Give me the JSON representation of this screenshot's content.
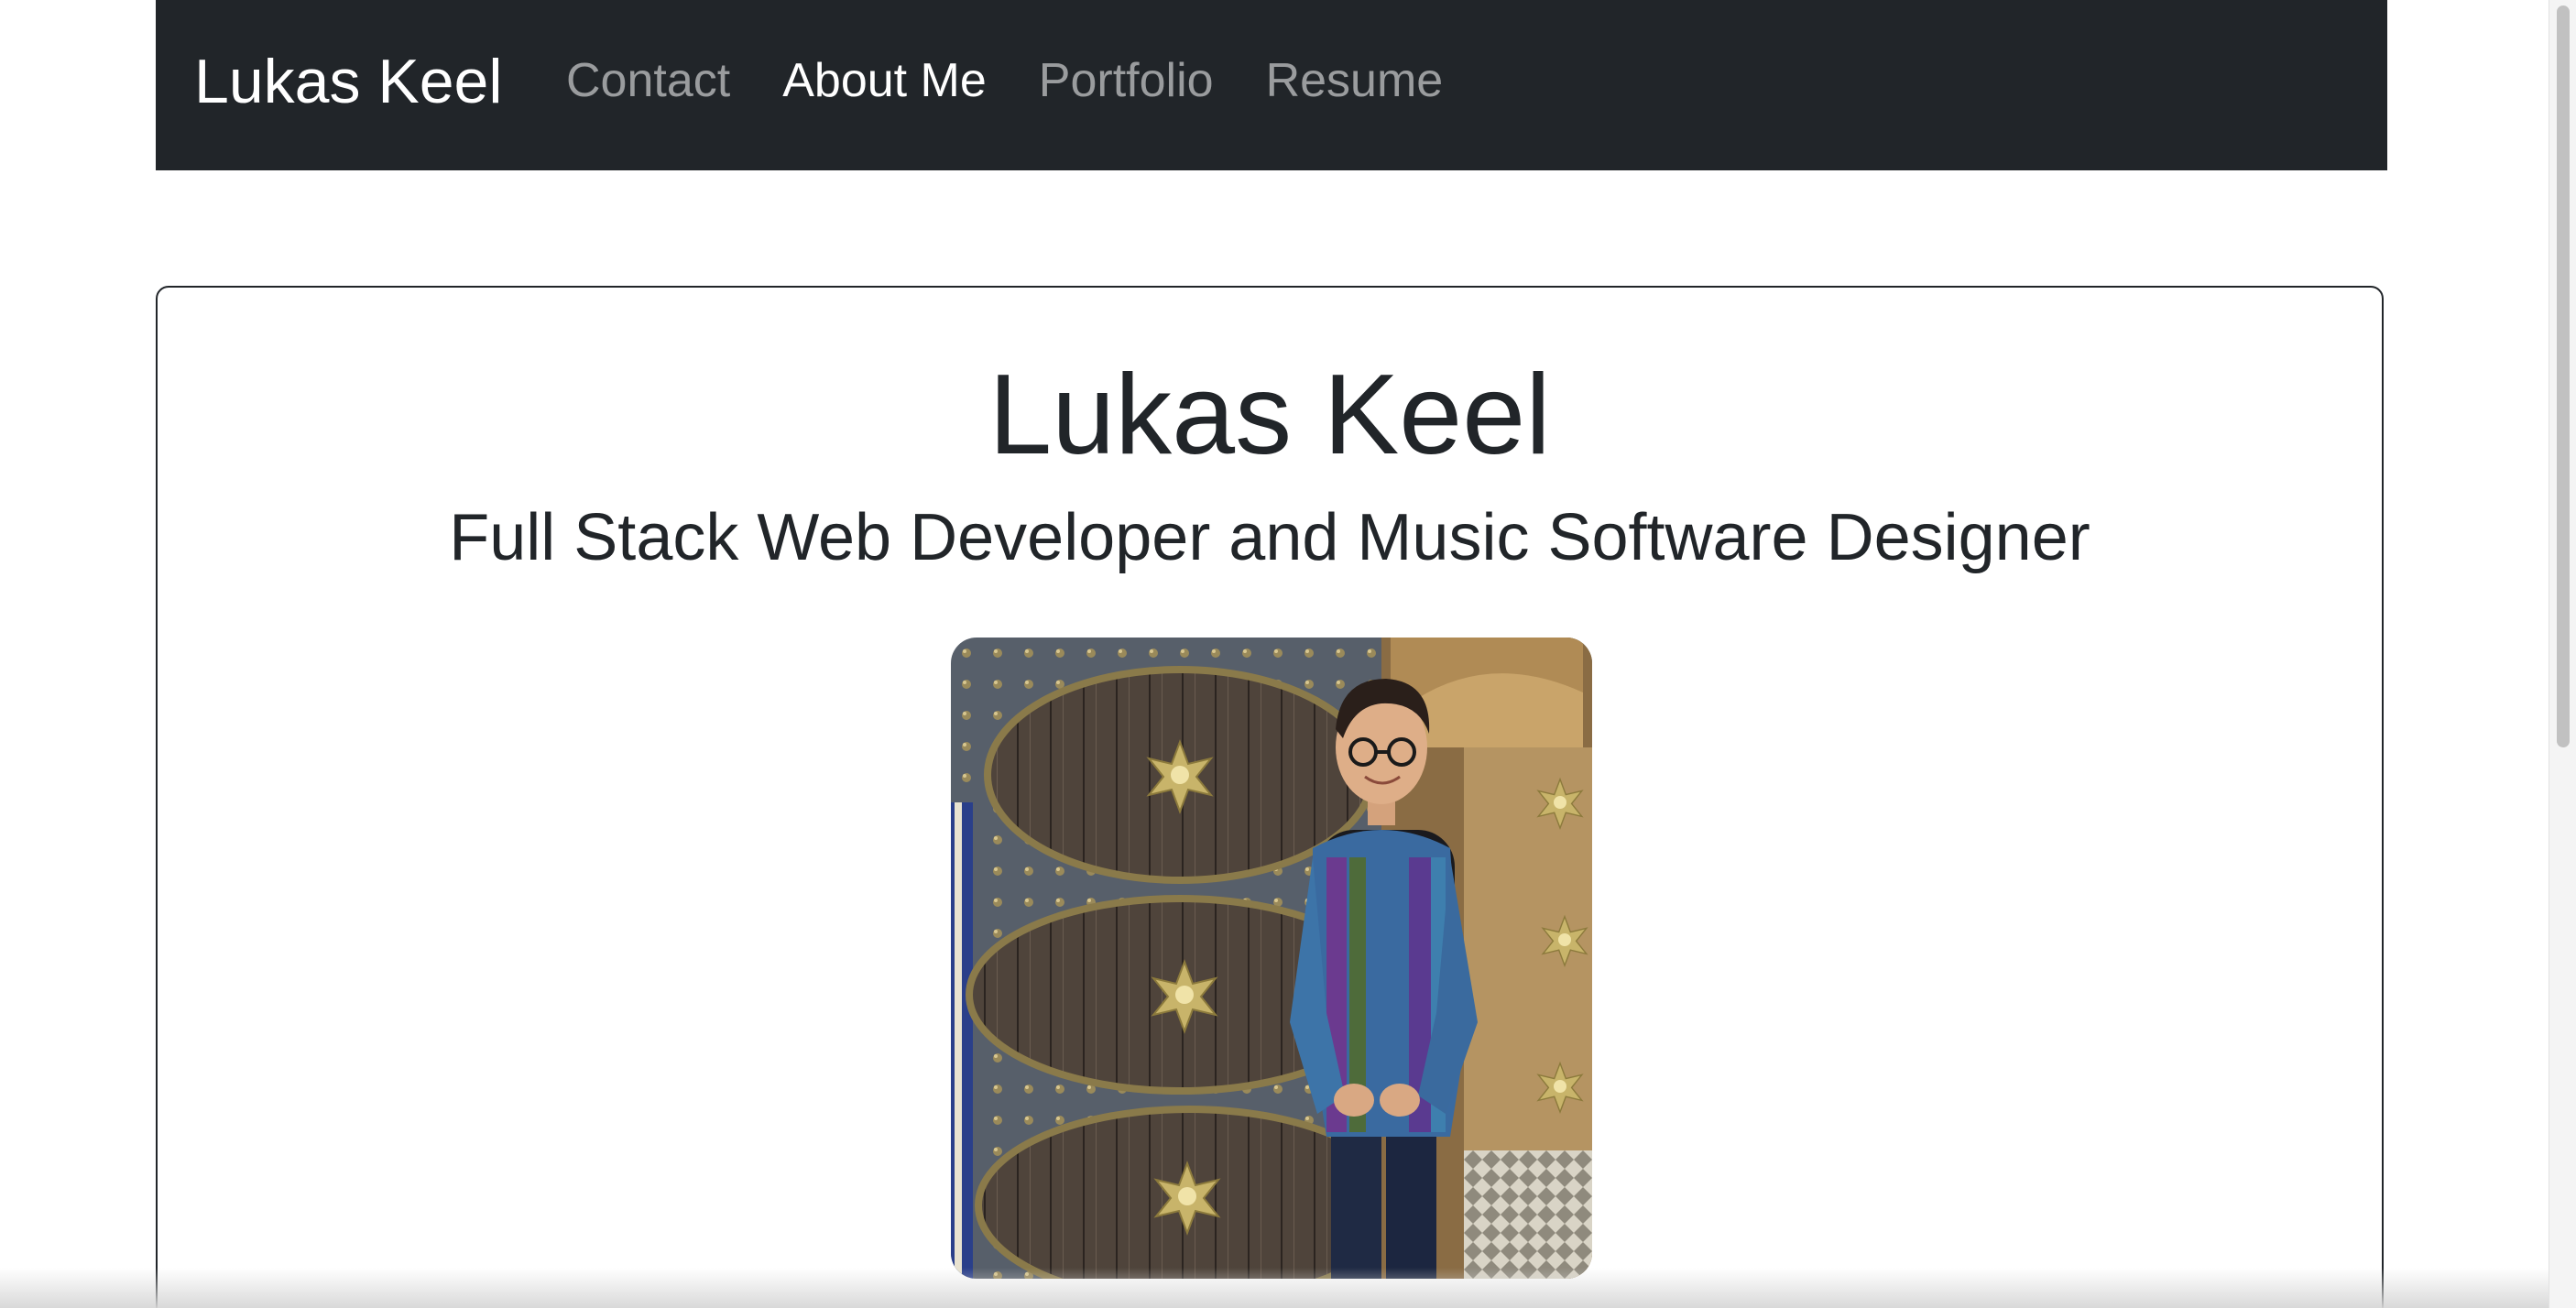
{
  "navbar": {
    "brand": "Lukas Keel",
    "links": [
      {
        "label": "Contact",
        "active": false
      },
      {
        "label": "About Me",
        "active": true
      },
      {
        "label": "Portfolio",
        "active": false
      },
      {
        "label": "Resume",
        "active": false
      }
    ],
    "background": "#212529"
  },
  "hero": {
    "title": "Lukas Keel",
    "subtitle": "Full Stack Web Developer and Music Software Designer"
  },
  "colors": {
    "text": "#212529",
    "nav_inactive": "rgba(255,255,255,0.55)",
    "nav_active": "#ffffff"
  }
}
